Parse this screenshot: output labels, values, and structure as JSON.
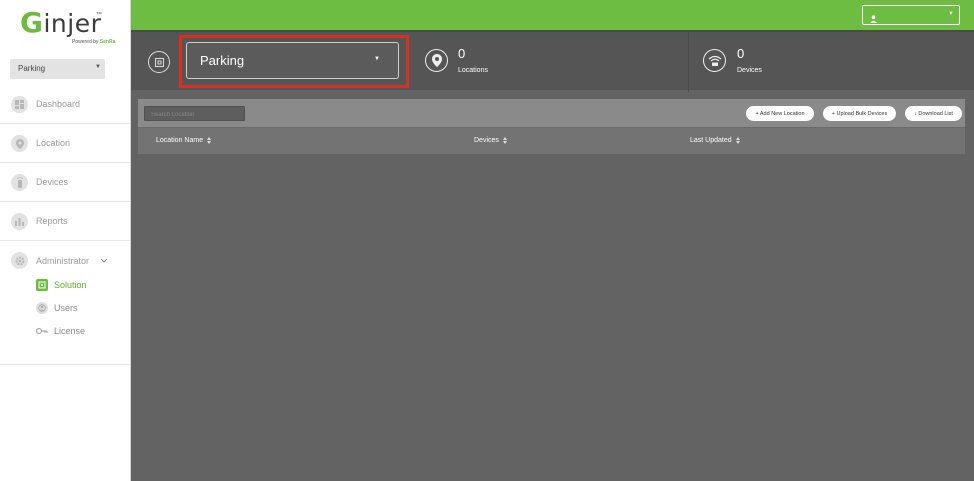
{
  "brand": {
    "name_letter": "G",
    "name_rest": "injer",
    "trademark": "™",
    "powered_prefix": "Powered by",
    "powered_brand": "SenRa"
  },
  "sidebar": {
    "solution_select": {
      "value": "Parking"
    },
    "items": [
      {
        "label": "Dashboard",
        "icon": "dashboard-icon"
      },
      {
        "label": "Location",
        "icon": "location-pin-icon"
      },
      {
        "label": "Devices",
        "icon": "device-icon"
      },
      {
        "label": "Reports",
        "icon": "bar-chart-icon"
      },
      {
        "label": "Administrator",
        "icon": "gear-icon"
      }
    ],
    "sub_items": [
      {
        "label": "Solution",
        "icon": "solution-icon",
        "active": true
      },
      {
        "label": "Users",
        "icon": "users-icon",
        "active": false
      },
      {
        "label": "License",
        "icon": "key-icon",
        "active": false
      }
    ]
  },
  "header": {
    "user_icon": "user-icon"
  },
  "stats": {
    "solution_select": {
      "value": "Parking"
    },
    "locations": {
      "count": "0",
      "label": "Locations"
    },
    "devices": {
      "count": "0",
      "label": "Devices"
    }
  },
  "toolbar": {
    "search_placeholder": "Search Location",
    "add_location": "+ Add New Location",
    "upload_bulk": "+ Upload Bulk Devices",
    "download_list": "↓ Download List"
  },
  "table": {
    "columns": [
      "Location Name",
      "Devices",
      "Last Updated"
    ]
  },
  "colors": {
    "accent_green": "#6cbd42",
    "highlight_red": "#d9311f",
    "panel_gray": "#636363"
  }
}
